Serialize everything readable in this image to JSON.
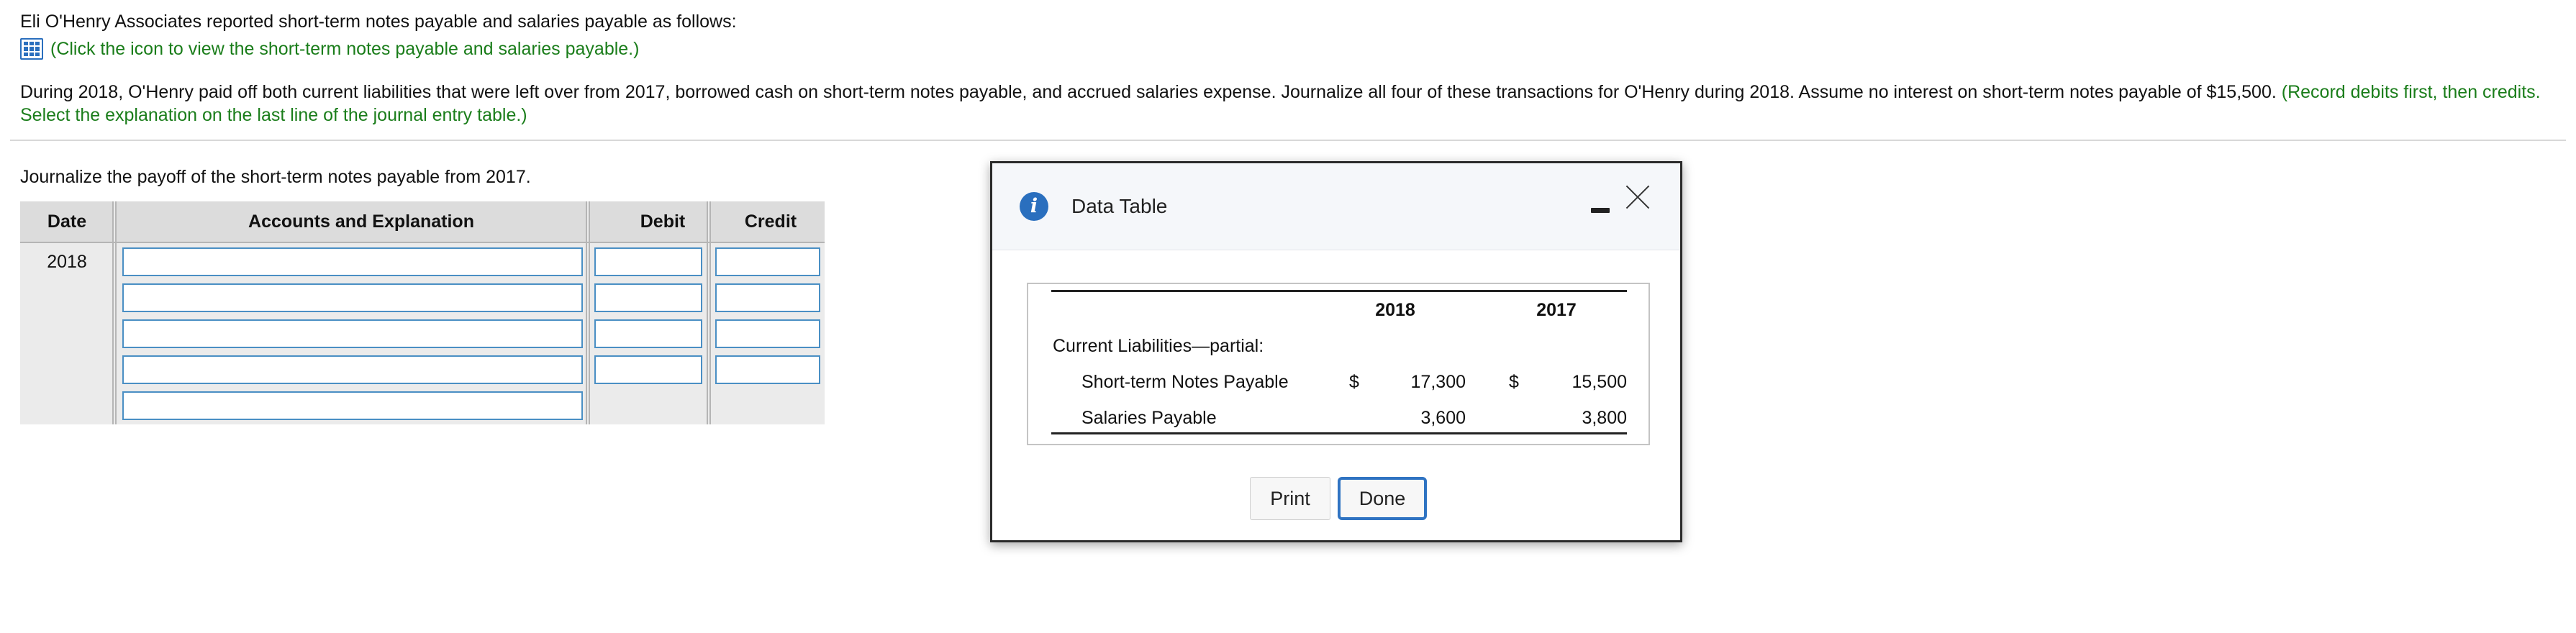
{
  "intro": "Eli O'Henry Associates reported short-term notes payable and salaries payable as follows:",
  "data_link": "(Click the icon to view the short-term notes payable and salaries payable.)",
  "problem": {
    "text": "During 2018, O'Henry paid off both current liabilities that were left over from 2017, borrowed cash on short-term notes payable, and accrued salaries expense. Journalize all four of these transactions for O'Henry during 2018. Assume no interest on short-term notes payable of $15,500.",
    "instruction": "(Record debits first, then credits. Select the explanation on the last line of the journal entry table.)"
  },
  "task": "Journalize the payoff of the short-term notes payable from 2017.",
  "journal": {
    "headers": [
      "Date",
      "Accounts and Explanation",
      "Debit",
      "Credit"
    ],
    "date": "2018"
  },
  "dialog": {
    "title": "Data Table",
    "info_icon": "i",
    "columns": [
      "2018",
      "2017"
    ],
    "section": "Current Liabilities—partial:",
    "rows": [
      {
        "label": "Short-term Notes Payable",
        "cur": "$",
        "v2018": "17,300",
        "cur2": "$",
        "v2017": "15,500"
      },
      {
        "label": "Salaries Payable",
        "cur": "",
        "v2018": "3,600",
        "cur2": "",
        "v2017": "3,800"
      }
    ],
    "print_label": "Print",
    "done_label": "Done"
  },
  "colors": {
    "accent": "#2a6fbe",
    "instruction_green": "#1a7d1a",
    "input_border": "#4a8fc4"
  }
}
